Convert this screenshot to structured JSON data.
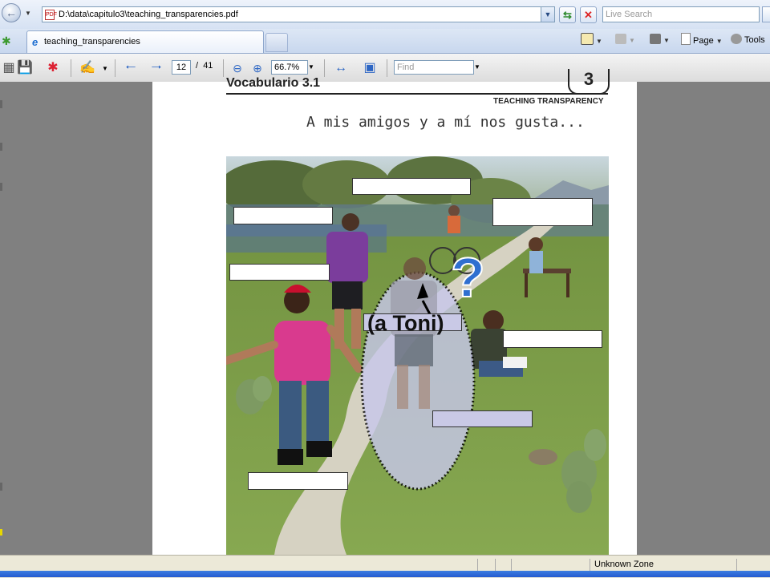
{
  "browser": {
    "address": "D:\\data\\capitulo3\\teaching_transparencies.pdf",
    "search_placeholder": "Live Search",
    "tab_title": "teaching_transparencies",
    "commands": {
      "page": "Page",
      "tools": "Tools"
    }
  },
  "pdf_toolbar": {
    "current_page": "12",
    "page_separator": "/",
    "total_pages": "41",
    "zoom": "66.7%",
    "find_placeholder": "Find"
  },
  "document": {
    "header": "Vocabulario 3.1",
    "chapter_number": "3",
    "banner": "TEACHING TRANSPARENCY",
    "subtitle": "A mis amigos y a mí nos gusta...",
    "annotation": "(a Toni)",
    "question_mark": "?"
  },
  "status_bar": {
    "zone": "Unknown Zone"
  },
  "colors": {
    "question_mark": "#2f6fd0",
    "ellipse_fill": "#c8c8ec"
  }
}
